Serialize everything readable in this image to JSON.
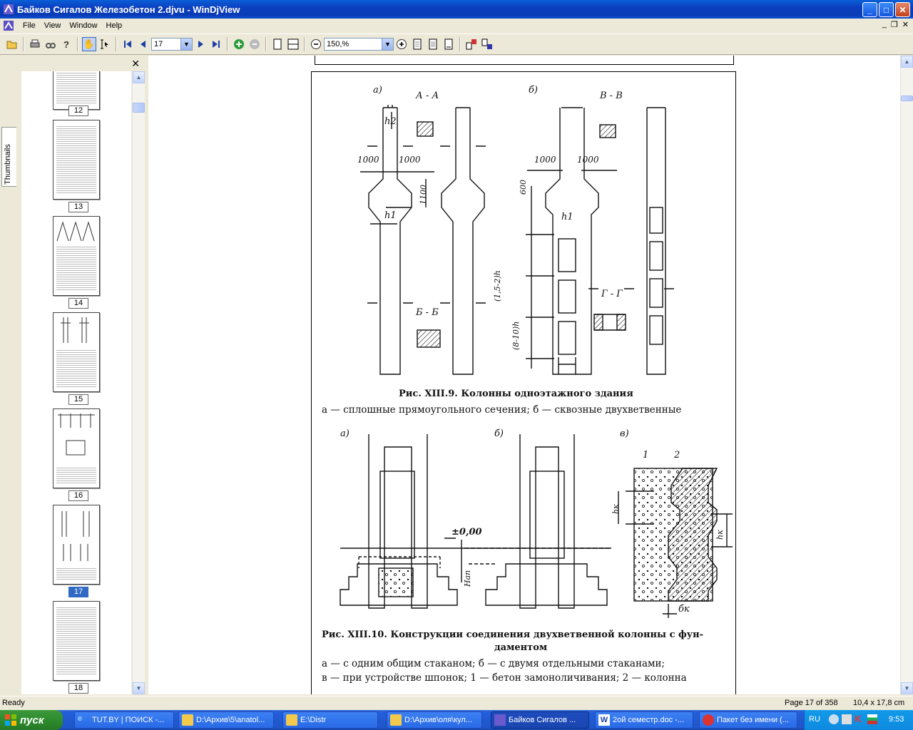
{
  "window": {
    "title": "Байков Сигалов Железобетон 2.djvu - WinDjView",
    "btn_min": "_",
    "btn_max": "□",
    "btn_close": "✕"
  },
  "menu": {
    "items": [
      "File",
      "View",
      "Window",
      "Help"
    ],
    "mdi_min": "_",
    "mdi_restore": "❐",
    "mdi_close": "✕"
  },
  "toolbar": {
    "page_value": "17",
    "zoom_value": "150,%"
  },
  "sidebar": {
    "tab_label": "Thumbnails",
    "close": "✕",
    "thumbs": [
      {
        "num": "12"
      },
      {
        "num": "13"
      },
      {
        "num": "14"
      },
      {
        "num": "15"
      },
      {
        "num": "16"
      },
      {
        "num": "17"
      },
      {
        "num": "18"
      }
    ],
    "current": "17"
  },
  "document": {
    "fig1_caption_title": "Рис. XIII.9. Колонны одноэтажного здания",
    "fig1_caption_text": "а — сплошные прямоугольного сечения; б — сквозные двухветвенные",
    "fig2_caption_title": "Рис. XIII.10. Конструкции соединения двухветвенной колонны с фун-",
    "fig2_caption_title2": "даментом",
    "fig2_caption_line1": "а — с одним общим стаканом; б — с двумя отдельными стаканами;",
    "fig2_caption_line2": "в — при устройстве шпонок; 1 — бетон замоноличивания; 2 — колонна",
    "labels": {
      "a": "а)",
      "b": "б)",
      "v": "в)",
      "AA": "А - А",
      "BB": "В - В",
      "BB2": "Б - Б",
      "GG": "Г - Г",
      "A": "А",
      "B": "В",
      "Bb": "Б",
      "G": "Г",
      "d1000": "1000",
      "d1100": "1100",
      "d600": "600",
      "h1": "h1",
      "h2": "h2",
      "h": "h",
      "bsym": "b",
      "span1": "(1,5-2)h",
      "span2": "(8-10)h",
      "level": "±0,00",
      "Hap": "Нап",
      "hk": "hк",
      "bk": "бк",
      "n1": "1",
      "n2": "2"
    }
  },
  "status": {
    "left": "Ready",
    "page": "Page 17 of 358",
    "size": "10,4 x 17,8 cm"
  },
  "taskbar": {
    "start": "пуск",
    "tasks": [
      "TUT.BY | ПОИСК -...",
      "D:\\Архив\\5\\anatol...",
      "E:\\Distr",
      "D:\\Архив\\оля\\кул...",
      "Байков Сигалов ...",
      "2ой семестр.doc -...",
      "Пакет без имени (..."
    ],
    "lang": "RU",
    "time": "9:53"
  }
}
